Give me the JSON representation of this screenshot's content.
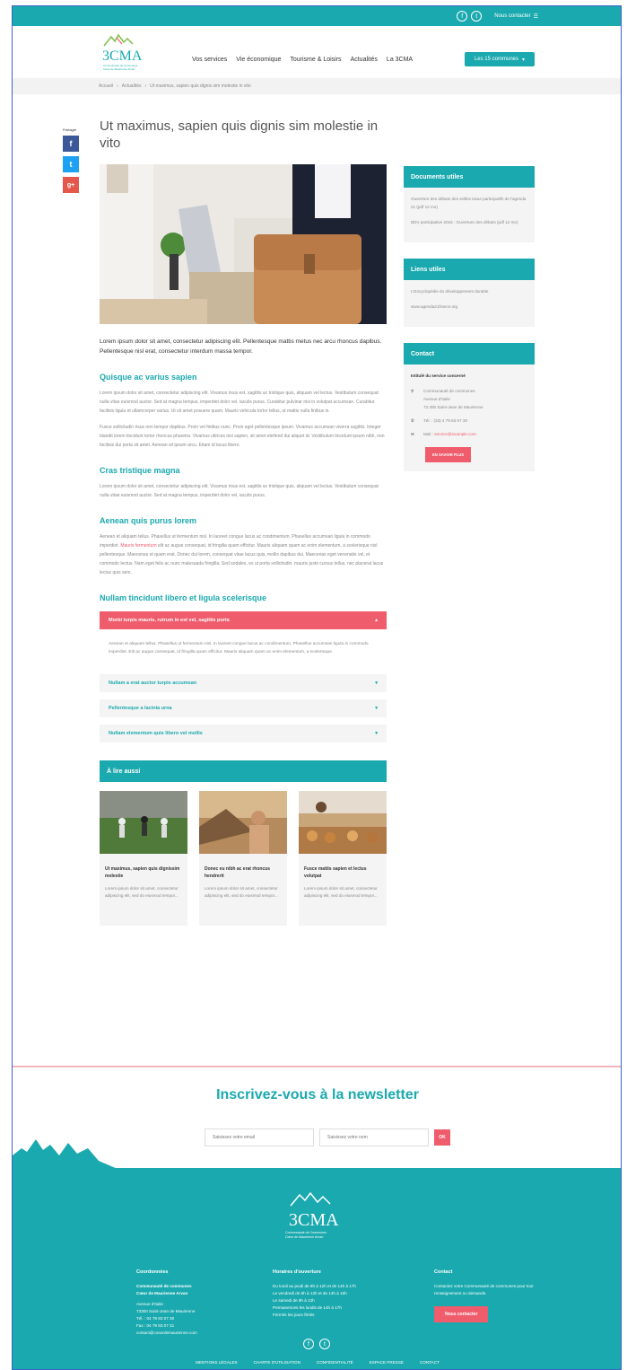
{
  "topbar": {
    "social": [
      "f",
      "t"
    ],
    "contact_label": "Nous contacter"
  },
  "header": {
    "logo_text": "3CMA",
    "logo_sub": "Communauté de Communes\nCœur de Maurienne Arvan",
    "nav": [
      "Vos services",
      "Vie économique",
      "Tourisme & Loisirs",
      "Actualités",
      "La 3CMA"
    ],
    "communes_label": "Les 15 communes"
  },
  "breadcrumb": [
    "Accueil",
    "Actualités",
    "Ut maximus, sapien quis dignis sim molestie in vito"
  ],
  "share": {
    "label": "Partager",
    "buttons": [
      "f",
      "t",
      "g+"
    ]
  },
  "article": {
    "title": "Ut maximus, sapien quis dignis sim molestie in vito",
    "lead": "Lorem ipsum dolor sit amet, consectetur adipiscing elit. Pellentesque mattis metus nec arcu rhoncus dapibus. Pellentesque nisl erat, consectetur interdum massa tempor.",
    "s1_title": "Quisque ac varius sapien",
    "s1_p1": "Lorem ipsum dolor sit amet, consectetur adipiscing elit. Vivamus risus est, sagittis ac tristique quis, aliquam vel lectus. Vestibulum consequat nulla vitae euismod auctor. Sed at magna tempus, imperdiet dolor vel, iaculis purus. Curabitur pulvinar nisi in volutpat accumsan. Curabitur facilisis ligula et ullamcorper varius. Ut sit amet posuere quam. Mauris vehicula tortor tellus, ut mattis nulla finibus in.",
    "s1_p2": "Fusce sollicitudin risus non tempor dapibus. Proin vel finibus nunc. Proin eget pellentesque ipsum. Vivamus accumsan viverra sagittis. Integer blandit lorem tincidunt tortor rhoncus pharetra. Vivamus ultrices nisi sapien, sit amet eleifend dui aliquet id. Vestibulum tincidunt ipsum nibh, non facilisis dui porta sit amet. Aenean sit ipsum arcu. Etiam id lacus libero.",
    "s2_title": "Cras tristique magna",
    "s2_p1": "Lorem ipsum dolor sit amet, consectetur adipiscing elit. Vivamus risus est, sagittis ac tristique quis, aliquam vel lectus. Vestibulum consequat nulla vitae euismod auctor. Sed at magna tempus, imperdiet dolor vel, iaculis purus.",
    "s3_title": "Aenean quis purus lorem",
    "s3_p1a": "Aenean et aliquam tellus. Phasellus ut fermentum nisl. In laoreet congue lacus ac condimentum. Phasellus accumsan ligula in commodo imperdiet. ",
    "s3_link": "Mauris fermentum",
    "s3_p1b": " elit ac augue consequat, id fringilla quam efficitur. Mauris aliquam quam ac enim elementum, a scelerisque nisl pellentesque. Maecenas et quam erat. Donec dui lorem, consequat vitae lacus quis, mollis dapibus dui. Maecenas eget venenatis vel, et commodo lectus. Nam eget felis ac nunc malesuada fringilla. Sed sodales, ex ut porta sollicitudin, mauris justo cursus tellus, nec placerat lacus lectus quis sem.",
    "s4_title": "Nullam tincidunt libero et ligula scelerisque",
    "accordion_open_title": "Morbi turpis mauris, rutrum in est vel, sagittis porta",
    "accordion_open_body": "Aenean et aliquam tellus. Phasellus ut fermentum nisl. In laoreet congue lacus ac condimentum. Phasellus accumsan ligula in commodo imperdiet. Elit ac augue consequat, id fringilla quam efficitur. Mauris aliquam quam ac enim elementum, a scelerisque.",
    "accordion_items": [
      "Nullam a erat auctor turpis accumsan",
      "Pellentesque a lacinia urna",
      "Nullam elementum quis libero vel mollis"
    ]
  },
  "alire": {
    "title": "À lire aussi",
    "cards": [
      {
        "title": "Ut maximus, sapien quis dignissim molestie",
        "text": "Lorem ipsum dolor sit amet, consectetur adipiscing elit, sed do eiusmod tempor..."
      },
      {
        "title": "Donec eu nibh ac erat rhoncus hendrerit",
        "text": "Lorem ipsum dolor sit amet, consectetur adipiscing elit, sed do eiusmod tempor..."
      },
      {
        "title": "Fusce mattis sapien et lectus volutpat",
        "text": "Lorem ipsum dolor sit amet, consectetur adipiscing elit, sed do eiusmod tempor..."
      }
    ]
  },
  "sidebar": {
    "docs_title": "Documents utiles",
    "docs": [
      "Ouverture des débats des veilles issue participatifs de l'agenda 21 (pdf 12 mo)",
      "BDV participative 2016 : Ouverture des débats (pdf 12 mo)"
    ],
    "links_title": "Liens utiles",
    "links": [
      "L'Encyclopédie du développement durable",
      "www.agenda21france.org"
    ],
    "contact_title": "Contact",
    "contact_service": "Intitulé du service concerné",
    "contact_address": "Communauté de communes\nAvenue d'Italie\n73 300 Saint-Jean de Maurienne",
    "contact_tel": "Tél. : (33) 4 79 83 07 30",
    "contact_mail_label": "Mail : ",
    "contact_mail": "service@example.com",
    "contact_btn": "EN SAVOIR PLUS"
  },
  "newsletter": {
    "title": "Inscrivez-vous à la newsletter",
    "email_placeholder": "Saisissez votre email",
    "code_placeholder": "Saisissez votre nom",
    "ok": "OK"
  },
  "footer": {
    "logo_text": "3CMA",
    "logo_sub": "Communauté de Communes\nCœur de Maurienne Arvan",
    "coord_title": "Coordonnées",
    "coord_name": "Communauté de communes\nCœur de Maurienne Arvan",
    "coord_lines": "Avenue d'Italie\n73300 Saint-Jean de Maurienne\nTél. : 04 79 83 07 30\nFax : 04 79 83 07 31\ncontact@coeurdemaurienne.com",
    "hours_title": "Horaires d'ouverture",
    "hours_lines": "Du lundi au jeudi de 8h à 12h et de 14h à 17h\nLe vendredi de 8h à 12h et de 14h à 16h\nLe samedi de 9h à 12h\nPermanences les lundis de 14h à 17h\nFermés les jours fériés",
    "contact_title": "Contact",
    "contact_text": "Contactez votre Communauté de communes pour tout renseignement ou demande.",
    "contact_btn": "Nous contacter",
    "links": [
      "MENTIONS LÉGALES",
      "CHARTE D'UTILISATION",
      "CONFIDENTIALITÉ",
      "ESPACE PRESSE",
      "CONTACT"
    ]
  },
  "colors": {
    "teal": "#1aa9ae",
    "red": "#ef5c6c"
  }
}
